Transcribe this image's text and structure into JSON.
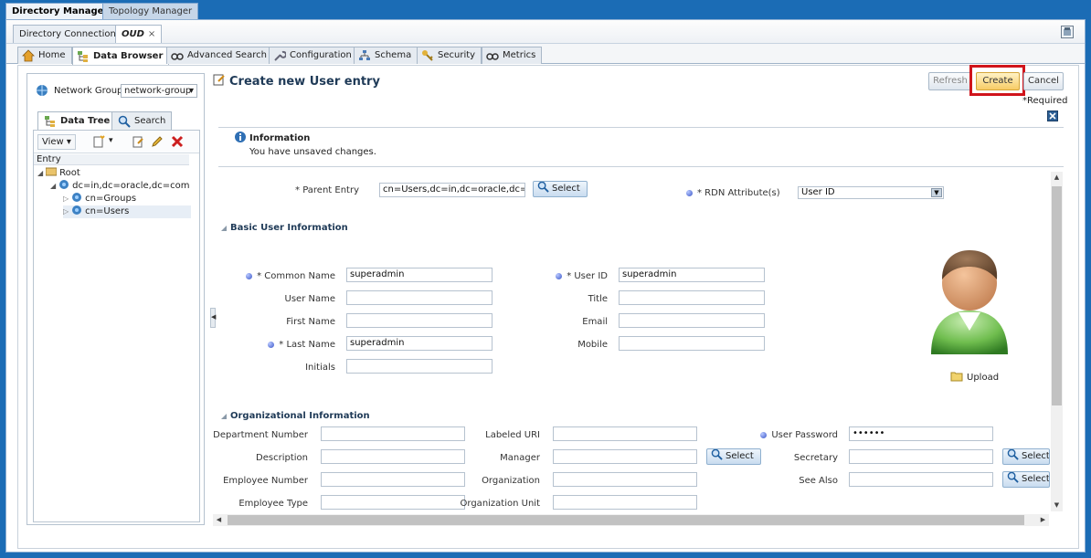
{
  "app_tabs": [
    {
      "label": "Directory Manager"
    },
    {
      "label": "Topology Manager"
    }
  ],
  "connection_tabs": [
    {
      "label": "Directory Connections"
    },
    {
      "label": "OUD",
      "close": "×"
    }
  ],
  "main_tabs": [
    {
      "label": "Home"
    },
    {
      "label": "Data Browser"
    },
    {
      "label": "Advanced Search"
    },
    {
      "label": "Configuration"
    },
    {
      "label": "Schema"
    },
    {
      "label": "Security"
    },
    {
      "label": "Metrics"
    }
  ],
  "left_panel": {
    "network_group_label": "Network Group",
    "network_group_value": "network-group",
    "tabs": [
      {
        "label": "Data Tree"
      },
      {
        "label": "Search"
      }
    ],
    "view_label": "View",
    "column_header": "Entry",
    "tree": [
      {
        "label": "Root"
      },
      {
        "label": "dc=in,dc=oracle,dc=com"
      },
      {
        "label": "cn=Groups"
      },
      {
        "label": "cn=Users"
      }
    ]
  },
  "form": {
    "title": "Create new User entry",
    "buttons": {
      "refresh": "Refresh",
      "create": "Create",
      "cancel": "Cancel"
    },
    "required_note": "*Required",
    "info_title": "Information",
    "info_message": "You have unsaved changes.",
    "parent_entry_label": "* Parent Entry",
    "parent_entry_value": "cn=Users,dc=in,dc=oracle,dc=com",
    "select_label": "Select",
    "rdn_label": "* RDN Attribute(s)",
    "rdn_value": "User ID",
    "basic_section": "Basic User Information",
    "common_name_label": "* Common Name",
    "common_name_value": "superadmin",
    "user_name_label": "User Name",
    "first_name_label": "First Name",
    "last_name_label": "* Last Name",
    "last_name_value": "superadmin",
    "initials_label": "Initials",
    "user_id_label": "* User ID",
    "user_id_value": "superadmin",
    "title_label": "Title",
    "email_label": "Email",
    "mobile_label": "Mobile",
    "upload_label": "Upload",
    "org_section": "Organizational Information",
    "department_label": "Department Number",
    "description_label": "Description",
    "employee_number_label": "Employee Number",
    "employee_type_label": "Employee Type",
    "labeled_uri_label": "Labeled URI",
    "manager_label": "Manager",
    "organization_label": "Organization",
    "org_unit_label": "Organization Unit",
    "user_password_label": "User Password",
    "user_password_value": "••••••",
    "secretary_label": "Secretary",
    "see_also_label": "See Also"
  },
  "colors": {
    "header_blue": "#1b6cb5",
    "create_button": "#f7cc66",
    "highlight_red": "#d0141b"
  }
}
